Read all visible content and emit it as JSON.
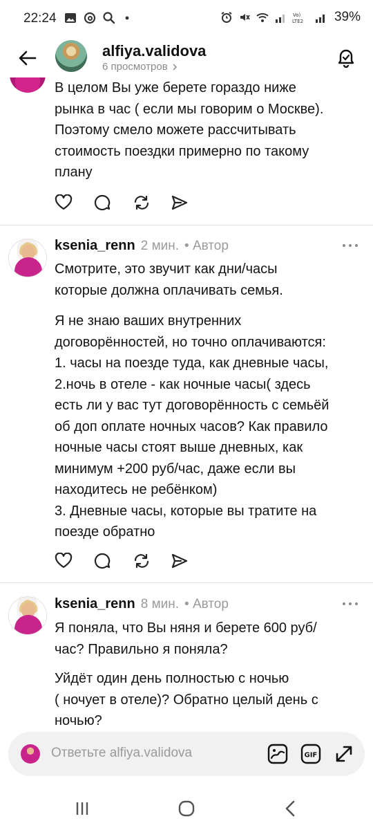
{
  "status": {
    "time": "22:24",
    "battery": "39%"
  },
  "header": {
    "username": "alfiya.validova",
    "views": "6 просмотров"
  },
  "comments": [
    {
      "text": "В целом Вы уже берете гораздо  ниже\nрынка в час ( если мы говорим о Москве).\nПоэтому смело можете рассчитывать\nстоимость поездки примерно по такому\nплану"
    },
    {
      "username": "ksenia_renn",
      "time": "2 мин.",
      "badge": "• Автор",
      "para1": "Смотрите, это звучит как дни/часы\nкоторые должна оплачивать семья.",
      "para2": "Я не знаю ваших внутренних\nдоговорённостей, но точно оплачиваются:\n1. часы на поезде туда, как дневные часы,\n2.ночь в отеле - как ночные часы( здесь\nесть ли у вас тут договорённость с семьёй\nоб доп оплате ночных часов? Как правило\nночные часы стоят выше дневных, как\nминимум +200 руб/час, даже если вы\nнаходитесь не ребёнком)\n3. Дневные часы, которые вы тратите на\nпоезде обратно"
    },
    {
      "username": "ksenia_renn",
      "time": "8 мин.",
      "badge": "• Автор",
      "para1": "Я поняла,  что Вы няня и берете 600 руб/\nчас? Правильно я поняла?",
      "para2": "Уйдёт один день полностью с ночью\n( ночует в отеле)? Обратно целый день с\nночью?"
    }
  ],
  "reply": {
    "placeholder": "Ответьте alfiya.validova"
  },
  "icons": {
    "like": "heart-icon",
    "comment": "comment-icon",
    "repost": "repost-icon",
    "share": "send-icon",
    "sticker": "sticker-icon",
    "gif": "gif-icon",
    "expand": "expand-icon"
  },
  "colors": {
    "meta": "#9a9a9a",
    "text": "#141414",
    "accent": "#c9238c"
  }
}
